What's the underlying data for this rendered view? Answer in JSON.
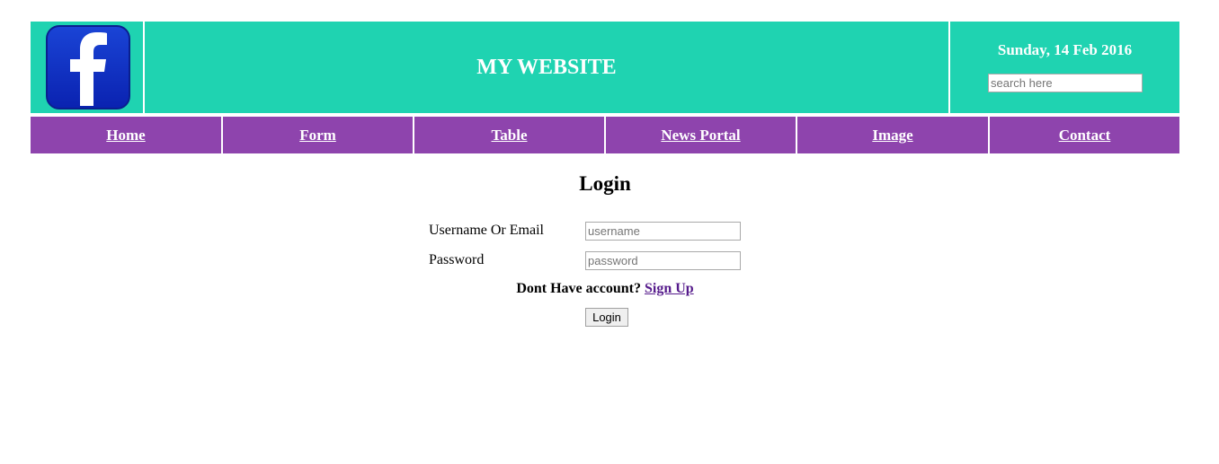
{
  "header": {
    "logo_icon": "facebook-icon",
    "site_title": "MY WEBSITE",
    "date": "Sunday, 14 Feb 2016",
    "search_placeholder": "search here"
  },
  "nav": {
    "items": [
      {
        "label": "Home"
      },
      {
        "label": "Form"
      },
      {
        "label": "Table"
      },
      {
        "label": "News Portal"
      },
      {
        "label": "Image"
      },
      {
        "label": "Contact"
      }
    ]
  },
  "login": {
    "title": "Login",
    "username_label": "Username Or Email",
    "username_placeholder": "username",
    "username_value": "",
    "password_label": "Password",
    "password_placeholder": "password",
    "password_value": "",
    "signup_prompt": "Dont Have account?",
    "signup_link": "Sign Up",
    "button_label": "Login"
  },
  "colors": {
    "header_bg": "#1fd3b1",
    "nav_bg": "#8e44ad",
    "link_visited": "#551a8b",
    "logo_blue": "#0a2fbf"
  }
}
